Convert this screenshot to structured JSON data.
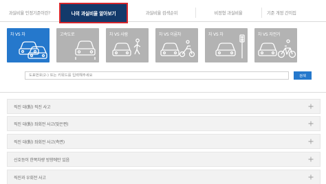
{
  "tabs": [
    {
      "label": "과실비율 인정기준이란?",
      "active": false
    },
    {
      "label": "나의 과실비율 알아보기",
      "active": true
    },
    {
      "label": "과실비율 검색순위",
      "active": false
    },
    {
      "label": "비정형 과실비율",
      "active": false
    },
    {
      "label": "기준 개정 간이집",
      "active": false
    }
  ],
  "categories": [
    {
      "label": "차 VS 차",
      "active": true,
      "icon": "car-vs-car-icon"
    },
    {
      "label": "고속도로",
      "active": false,
      "icon": "highway-icon"
    },
    {
      "label": "차 VS 사람",
      "active": false,
      "icon": "car-vs-pedestrian-icon"
    },
    {
      "label": "차 VS 이륜차",
      "active": false,
      "icon": "car-vs-motorcycle-icon"
    },
    {
      "label": "자 VS 차",
      "active": false,
      "icon": "road-scene-icon"
    },
    {
      "label": "차 VS 자전거",
      "active": false,
      "icon": "car-vs-bicycle-icon"
    }
  ],
  "search": {
    "placeholder": "도표번호(2-) 또는 키워드를 입력해주세요",
    "button_label": "검색"
  },
  "accordion": [
    "직진 대(對) 직진 사고",
    "직진 대(對) 좌회전 사고(맞은편)",
    "직진 대(對) 좌회전 사고(측면)",
    "신호등이 한쪽차량 방향에만 있음",
    "직진과 우회전 사고"
  ],
  "colors": {
    "active_tab": "#133a6b",
    "active_tab_border": "#d7262b",
    "accent_blue": "#2578cc",
    "inactive_card": "#b3b3b3",
    "accordion_bg": "#f2f2f2"
  }
}
